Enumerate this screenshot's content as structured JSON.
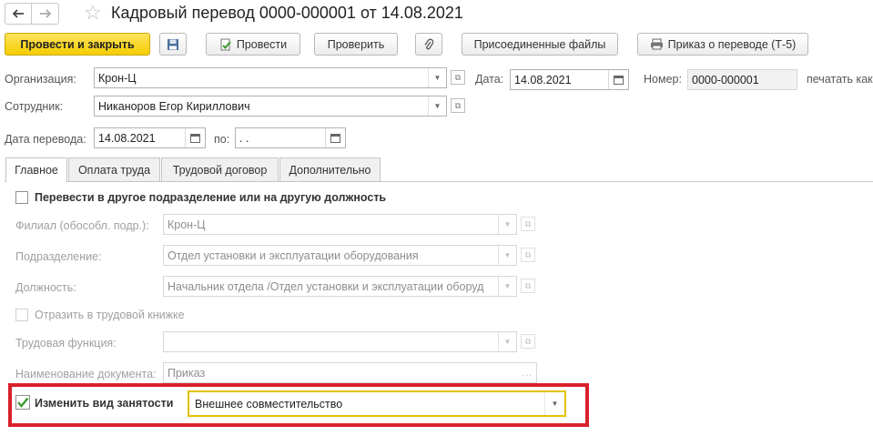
{
  "header": {
    "title": "Кадровый перевод 0000-000001 от 14.08.2021",
    "back_icon": "arrow-left-icon",
    "forward_icon": "arrow-right-icon",
    "favorite_icon": "star-icon"
  },
  "toolbar": {
    "post_and_close": "Провести и закрыть",
    "save_icon": "floppy-disk-icon",
    "post": "Провести",
    "check": "Проверить",
    "attach_icon": "paperclip-icon",
    "attached_files": "Присоединенные файлы",
    "print_order": "Приказ о переводе (Т-5)"
  },
  "form": {
    "organization_label": "Организация:",
    "organization_value": "Крон-Ц",
    "date_label": "Дата:",
    "date_value": "14.08.2021",
    "number_label": "Номер:",
    "number_value": "0000-000001",
    "print_as_label": "печатать как",
    "employee_label": "Сотрудник:",
    "employee_value": "Никаноров Егор Кириллович",
    "transfer_date_label": "Дата перевода:",
    "transfer_date_value": "14.08.2021",
    "to_label": "по:",
    "to_value": " .  ."
  },
  "tabs": [
    {
      "label": "Главное",
      "active": true
    },
    {
      "label": "Оплата труда",
      "active": false
    },
    {
      "label": "Трудовой договор",
      "active": false
    },
    {
      "label": "Дополнительно",
      "active": false
    }
  ],
  "main": {
    "transfer_checkbox_label": "Перевести в другое подразделение или на другую должность",
    "transfer_checked": false,
    "branch_label": "Филиал (обособл. подр.):",
    "branch_value": "Крон-Ц",
    "department_label": "Подразделение:",
    "department_value": "Отдел установки и эксплуатации оборудования",
    "position_label": "Должность:",
    "position_value": "Начальник отдела /Отдел установки и эксплуатации оборуд",
    "workbook_label": "Отразить в трудовой книжке",
    "labor_function_label": "Трудовая функция:",
    "labor_function_value": "",
    "doc_name_label": "Наименование документа:",
    "doc_name_value": "Приказ",
    "change_employment_label": "Изменить вид занятости",
    "change_employment_checked": true,
    "employment_type_value": "Внешнее совместительство"
  },
  "colors": {
    "primary_button": "#f5cd00",
    "highlight_frame": "#d9212b",
    "active_field_border": "#e2c200"
  }
}
